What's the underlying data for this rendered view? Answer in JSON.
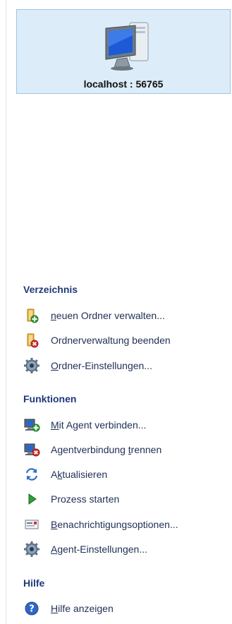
{
  "host": {
    "label": "localhost : 56765",
    "icon": "computer-monitor-icon"
  },
  "sections": {
    "verzeichnis": {
      "title": "Verzeichnis",
      "items": [
        {
          "pre": "",
          "u": "n",
          "post": "euen Ordner verwalten...",
          "icon": "folder-add-icon"
        },
        {
          "pre": "Ordnerverwaltung beenden",
          "u": "",
          "post": "",
          "icon": "folder-remove-icon"
        },
        {
          "pre": "",
          "u": "O",
          "post": "rdner-Einstellungen...",
          "icon": "gear-icon"
        }
      ]
    },
    "funktionen": {
      "title": "Funktionen",
      "items": [
        {
          "pre": "",
          "u": "M",
          "post": "it Agent verbinden...",
          "icon": "connect-computer-icon"
        },
        {
          "pre": "Agentverbindung ",
          "u": "t",
          "post": "rennen",
          "icon": "disconnect-computer-icon"
        },
        {
          "pre": "A",
          "u": "k",
          "post": "tualisieren",
          "icon": "refresh-icon"
        },
        {
          "pre": "Prozess starten",
          "u": "",
          "post": "",
          "icon": "play-icon"
        },
        {
          "pre": "",
          "u": "B",
          "post": "enachrichtigungsoptionen...",
          "icon": "notification-icon"
        },
        {
          "pre": "",
          "u": "A",
          "post": "gent-Einstellungen...",
          "icon": "gear-icon"
        }
      ]
    },
    "hilfe": {
      "title": "Hilfe",
      "items": [
        {
          "pre": "",
          "u": "H",
          "post": "ilfe anzeigen",
          "icon": "help-icon"
        }
      ]
    }
  }
}
